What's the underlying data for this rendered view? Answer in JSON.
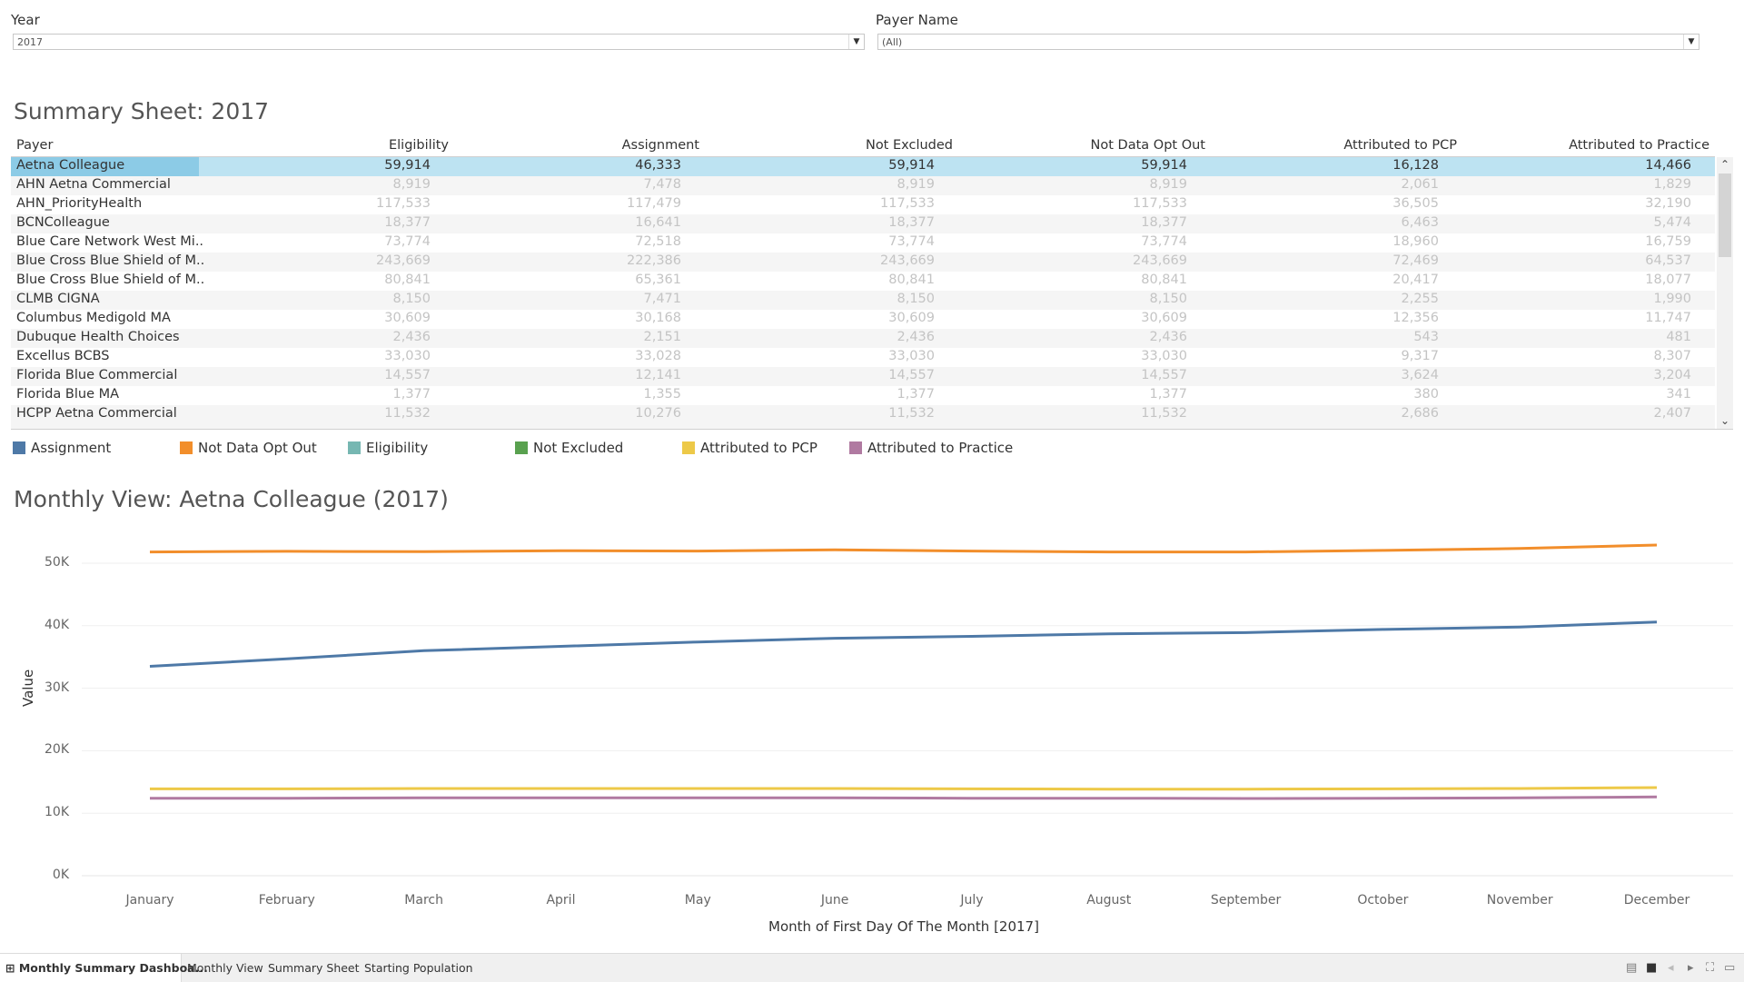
{
  "filters": {
    "year": {
      "label": "Year",
      "value": "2017"
    },
    "payer": {
      "label": "Payer Name",
      "value": "(All)"
    }
  },
  "summary": {
    "title": "Summary Sheet: 2017",
    "columns": [
      "Payer",
      "Eligibility",
      "Assignment",
      "Not Excluded",
      "Not Data Opt Out",
      "Attributed to PCP",
      "Attributed to Practice"
    ],
    "rows": [
      {
        "payer": "Aetna Colleague",
        "values": [
          "59,914",
          "46,333",
          "59,914",
          "59,914",
          "16,128",
          "14,466"
        ]
      },
      {
        "payer": "AHN Aetna Commercial",
        "values": [
          "8,919",
          "7,478",
          "8,919",
          "8,919",
          "2,061",
          "1,829"
        ]
      },
      {
        "payer": "AHN_PriorityHealth",
        "values": [
          "117,533",
          "117,479",
          "117,533",
          "117,533",
          "36,505",
          "32,190"
        ]
      },
      {
        "payer": "BCNColleague",
        "values": [
          "18,377",
          "16,641",
          "18,377",
          "18,377",
          "6,463",
          "5,474"
        ]
      },
      {
        "payer": "Blue Care Network West Mi..",
        "values": [
          "73,774",
          "72,518",
          "73,774",
          "73,774",
          "18,960",
          "16,759"
        ]
      },
      {
        "payer": "Blue Cross Blue Shield of M..",
        "values": [
          "243,669",
          "222,386",
          "243,669",
          "243,669",
          "72,469",
          "64,537"
        ]
      },
      {
        "payer": "Blue Cross Blue Shield of M..",
        "values": [
          "80,841",
          "65,361",
          "80,841",
          "80,841",
          "20,417",
          "18,077"
        ]
      },
      {
        "payer": "CLMB CIGNA",
        "values": [
          "8,150",
          "7,471",
          "8,150",
          "8,150",
          "2,255",
          "1,990"
        ]
      },
      {
        "payer": "Columbus Medigold MA",
        "values": [
          "30,609",
          "30,168",
          "30,609",
          "30,609",
          "12,356",
          "11,747"
        ]
      },
      {
        "payer": "Dubuque Health Choices",
        "values": [
          "2,436",
          "2,151",
          "2,436",
          "2,436",
          "543",
          "481"
        ]
      },
      {
        "payer": "Excellus BCBS",
        "values": [
          "33,030",
          "33,028",
          "33,030",
          "33,030",
          "9,317",
          "8,307"
        ]
      },
      {
        "payer": "Florida Blue Commercial",
        "values": [
          "14,557",
          "12,141",
          "14,557",
          "14,557",
          "3,624",
          "3,204"
        ]
      },
      {
        "payer": "Florida Blue MA",
        "values": [
          "1,377",
          "1,355",
          "1,377",
          "1,377",
          "380",
          "341"
        ]
      },
      {
        "payer": "HCPP Aetna Commercial",
        "values": [
          "11,532",
          "10,276",
          "11,532",
          "11,532",
          "2,686",
          "2,407"
        ]
      }
    ],
    "selected_index": 0
  },
  "legend": [
    {
      "label": "Assignment",
      "color": "#4e79a7"
    },
    {
      "label": "Not Data Opt Out",
      "color": "#f28e2b"
    },
    {
      "label": "Eligibility",
      "color": "#76b7b2"
    },
    {
      "label": "Not Excluded",
      "color": "#59a14f"
    },
    {
      "label": "Attributed to PCP",
      "color": "#edc948"
    },
    {
      "label": "Attributed to Practice",
      "color": "#b07aa1"
    }
  ],
  "monthly": {
    "title": "Monthly View: Aetna Colleague (2017)"
  },
  "chart_data": {
    "type": "line",
    "title": "Monthly View: Aetna Colleague (2017)",
    "xlabel": "Month of First Day Of The Month [2017]",
    "ylabel": "Value",
    "ylim": [
      0,
      55000
    ],
    "yticks": [
      "0K",
      "10K",
      "20K",
      "30K",
      "40K",
      "50K"
    ],
    "x": [
      "January",
      "February",
      "March",
      "April",
      "May",
      "June",
      "July",
      "August",
      "September",
      "October",
      "November",
      "December"
    ],
    "grid": true,
    "series": [
      {
        "name": "Not Data Opt Out",
        "color": "#f28e2b",
        "values": [
          51800,
          51900,
          51850,
          52000,
          51950,
          52150,
          51950,
          51800,
          51800,
          52050,
          52350,
          52900
        ]
      },
      {
        "name": "Assignment",
        "color": "#4e79a7",
        "values": [
          33500,
          34700,
          36000,
          36700,
          37400,
          38000,
          38300,
          38700,
          38900,
          39400,
          39800,
          40600
        ]
      },
      {
        "name": "Attributed to PCP",
        "color": "#edc948",
        "values": [
          13900,
          13900,
          13950,
          13950,
          13950,
          13950,
          13900,
          13850,
          13850,
          13900,
          13950,
          14100
        ]
      },
      {
        "name": "Attributed to Practice",
        "color": "#b07aa1",
        "values": [
          12400,
          12400,
          12450,
          12450,
          12450,
          12450,
          12400,
          12400,
          12350,
          12400,
          12450,
          12600
        ]
      }
    ]
  },
  "tabs": [
    "Monthly Summary Dashboa...",
    "Monthly View",
    "Summary Sheet",
    "Starting Population"
  ]
}
